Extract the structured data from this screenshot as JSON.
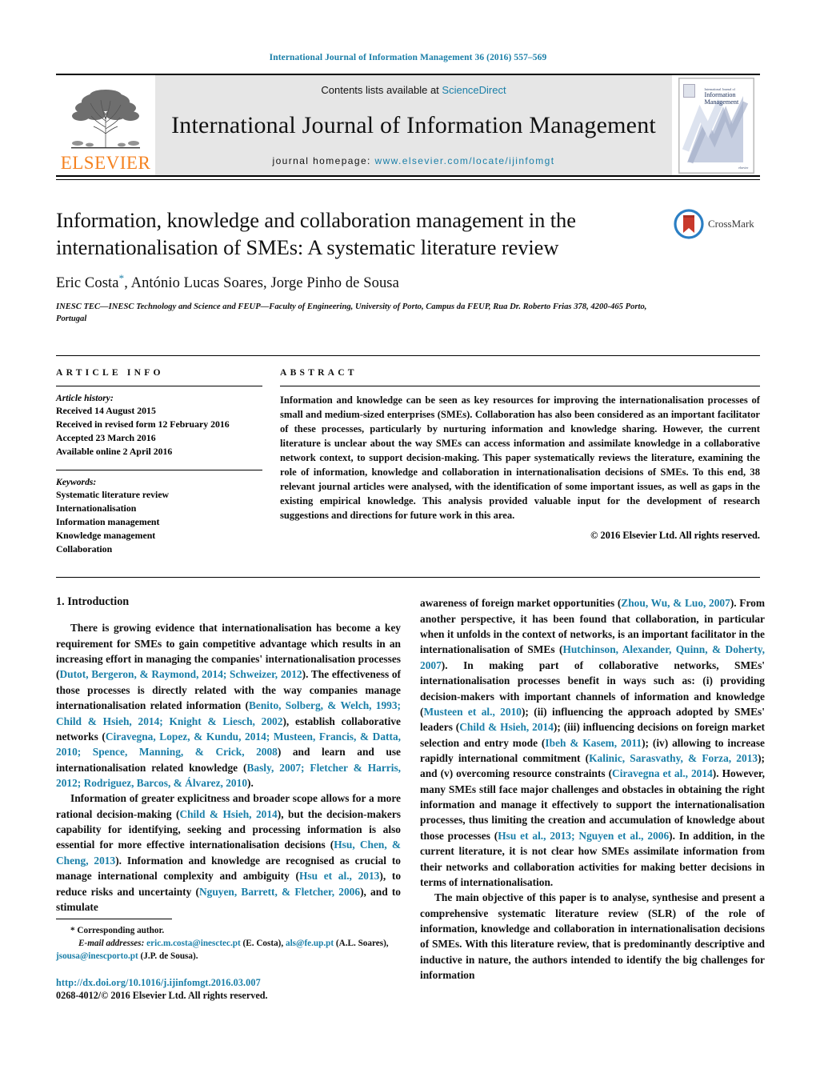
{
  "running_head": "International Journal of Information Management 36 (2016) 557–569",
  "masthead": {
    "publisher_name": "ELSEVIER",
    "contents_prefix": "Contents lists available at ",
    "contents_link": "ScienceDirect",
    "journal_title": "International Journal of Information Management",
    "homepage_label": "journal homepage:",
    "homepage_url": "www.elsevier.com/locate/ijinfomgt",
    "cover": {
      "superline": "International Journal of",
      "line1": "Information",
      "line2": "Management",
      "footer": "elsevier"
    }
  },
  "article": {
    "title": "Information, knowledge and collaboration management in the internationalisation of SMEs: A systematic literature review",
    "authors": "Eric Costa",
    "authors_rest": ", António Lucas Soares, Jorge Pinho de Sousa",
    "corresponding_marker": "*",
    "affiliation": "INESC TEC—INESC Technology and Science and FEUP—Faculty of Engineering, University of Porto, Campus da FEUP, Rua Dr. Roberto Frias 378, 4200-465 Porto, Portugal",
    "crossmark_label": "CrossMark"
  },
  "article_info": {
    "heading": "ARTICLE INFO",
    "history_label": "Article history:",
    "history": [
      "Received 14 August 2015",
      "Received in revised form 12 February 2016",
      "Accepted 23 March 2016",
      "Available online 2 April 2016"
    ],
    "keywords_label": "Keywords:",
    "keywords": [
      "Systematic literature review",
      "Internationalisation",
      "Information management",
      "Knowledge management",
      "Collaboration"
    ]
  },
  "abstract": {
    "heading": "ABSTRACT",
    "text": "Information and knowledge can be seen as key resources for improving the internationalisation processes of small and medium-sized enterprises (SMEs). Collaboration has also been considered as an important facilitator of these processes, particularly by nurturing information and knowledge sharing. However, the current literature is unclear about the way SMEs can access information and assimilate knowledge in a collaborative network context, to support decision-making. This paper systematically reviews the literature, examining the role of information, knowledge and collaboration in internationalisation decisions of SMEs. To this end, 38 relevant journal articles were analysed, with the identification of some important issues, as well as gaps in the existing empirical knowledge. This analysis provided valuable input for the development of research suggestions and directions for future work in this area.",
    "copyright": "© 2016 Elsevier Ltd. All rights reserved."
  },
  "body": {
    "section_title": "1. Introduction",
    "left_paragraphs": [
      {
        "segments": [
          {
            "t": "There is growing evidence that internationalisation has become a key requirement for SMEs to gain competitive advantage which results in an increasing effort in managing the companies' internationalisation processes (",
            "link": false
          },
          {
            "t": "Dutot, Bergeron, & Raymond, 2014; Schweizer, 2012",
            "link": true
          },
          {
            "t": "). The effectiveness of those processes is directly related with the way companies manage internationalisation related information (",
            "link": false
          },
          {
            "t": "Benito, Solberg, & Welch, 1993; Child & Hsieh, 2014; Knight & Liesch, 2002",
            "link": true
          },
          {
            "t": "), establish collaborative networks (",
            "link": false
          },
          {
            "t": "Ciravegna, Lopez, & Kundu, 2014; Musteen, Francis, & Datta, 2010; Spence, Manning, & Crick, 2008",
            "link": true
          },
          {
            "t": ") and learn and use internationalisation related knowledge (",
            "link": false
          },
          {
            "t": "Basly, 2007; Fletcher & Harris, 2012; Rodriguez, Barcos, & Álvarez, 2010",
            "link": true
          },
          {
            "t": ").",
            "link": false
          }
        ]
      },
      {
        "segments": [
          {
            "t": "Information of greater explicitness and broader scope allows for a more rational decision-making (",
            "link": false
          },
          {
            "t": "Child & Hsieh, 2014",
            "link": true
          },
          {
            "t": "), but the decision-makers capability for identifying, seeking and processing information is also essential for more effective internationalisation decisions (",
            "link": false
          },
          {
            "t": "Hsu, Chen, & Cheng, 2013",
            "link": true
          },
          {
            "t": "). Information and knowledge are recognised as crucial to manage international complexity and ambiguity (",
            "link": false
          },
          {
            "t": "Hsu et al., 2013",
            "link": true
          },
          {
            "t": "), to reduce risks and uncertainty (",
            "link": false
          },
          {
            "t": "Nguyen, Barrett, & Fletcher, 2006",
            "link": true
          },
          {
            "t": "), and to stimulate",
            "link": false
          }
        ]
      }
    ],
    "right_paragraphs": [
      {
        "continuation": true,
        "segments": [
          {
            "t": "awareness of foreign market opportunities (",
            "link": false
          },
          {
            "t": "Zhou, Wu, & Luo, 2007",
            "link": true
          },
          {
            "t": "). From another perspective, it has been found that collaboration, in particular when it unfolds in the context of networks, is an important facilitator in the internationalisation of SMEs (",
            "link": false
          },
          {
            "t": "Hutchinson, Alexander, Quinn, & Doherty, 2007",
            "link": true
          },
          {
            "t": "). In making part of collaborative networks, SMEs' internationalisation processes benefit in ways such as: (i) providing decision-makers with important channels of information and knowledge (",
            "link": false
          },
          {
            "t": "Musteen et al., 2010",
            "link": true
          },
          {
            "t": "); (ii) influencing the approach adopted by SMEs' leaders (",
            "link": false
          },
          {
            "t": "Child & Hsieh, 2014",
            "link": true
          },
          {
            "t": "); (iii) influencing decisions on foreign market selection and entry mode (",
            "link": false
          },
          {
            "t": "Ibeh & Kasem, 2011",
            "link": true
          },
          {
            "t": "); (iv) allowing to increase rapidly international commitment (",
            "link": false
          },
          {
            "t": "Kalinic, Sarasvathy, & Forza, 2013",
            "link": true
          },
          {
            "t": "); and (v) overcoming resource constraints (",
            "link": false
          },
          {
            "t": "Ciravegna et al., 2014",
            "link": true
          },
          {
            "t": "). However, many SMEs still face major challenges and obstacles in obtaining the right information and manage it effectively to support the internationalisation processes, thus limiting the creation and accumulation of knowledge about those processes (",
            "link": false
          },
          {
            "t": "Hsu et al., 2013; Nguyen et al., 2006",
            "link": true
          },
          {
            "t": "). In addition, in the current literature, it is not clear how SMEs assimilate information from their networks and collaboration activities for making better decisions in terms of internationalisation.",
            "link": false
          }
        ]
      },
      {
        "continuation": false,
        "segments": [
          {
            "t": "The main objective of this paper is to analyse, synthesise and present a comprehensive systematic literature review (SLR) of the role of information, knowledge and collaboration in internationalisation decisions of SMEs. With this literature review, that is predominantly descriptive and inductive in nature, the authors intended to identify the big challenges for information",
            "link": false
          }
        ]
      }
    ]
  },
  "footnotes": {
    "corresponding_marker": "*",
    "corresponding_text": "Corresponding author.",
    "email_label": "E-mail addresses:",
    "emails": [
      {
        "address": "eric.m.costa@inesctec.pt",
        "person": " (E. Costa), "
      },
      {
        "address": "als@fe.up.pt",
        "person": " (A.L. Soares), "
      },
      {
        "address": "jsousa@inescporto.pt",
        "person": " (J.P. de Sousa)."
      }
    ],
    "doi": "http://dx.doi.org/10.1016/j.ijinfomgt.2016.03.007",
    "issn": "0268-4012/© 2016 Elsevier Ltd. All rights reserved."
  },
  "colors": {
    "link": "#1a7fa8",
    "elsevier_orange": "#F58220",
    "crossmark_blue": "#2b7fc4",
    "crossmark_red": "#c8392b"
  }
}
